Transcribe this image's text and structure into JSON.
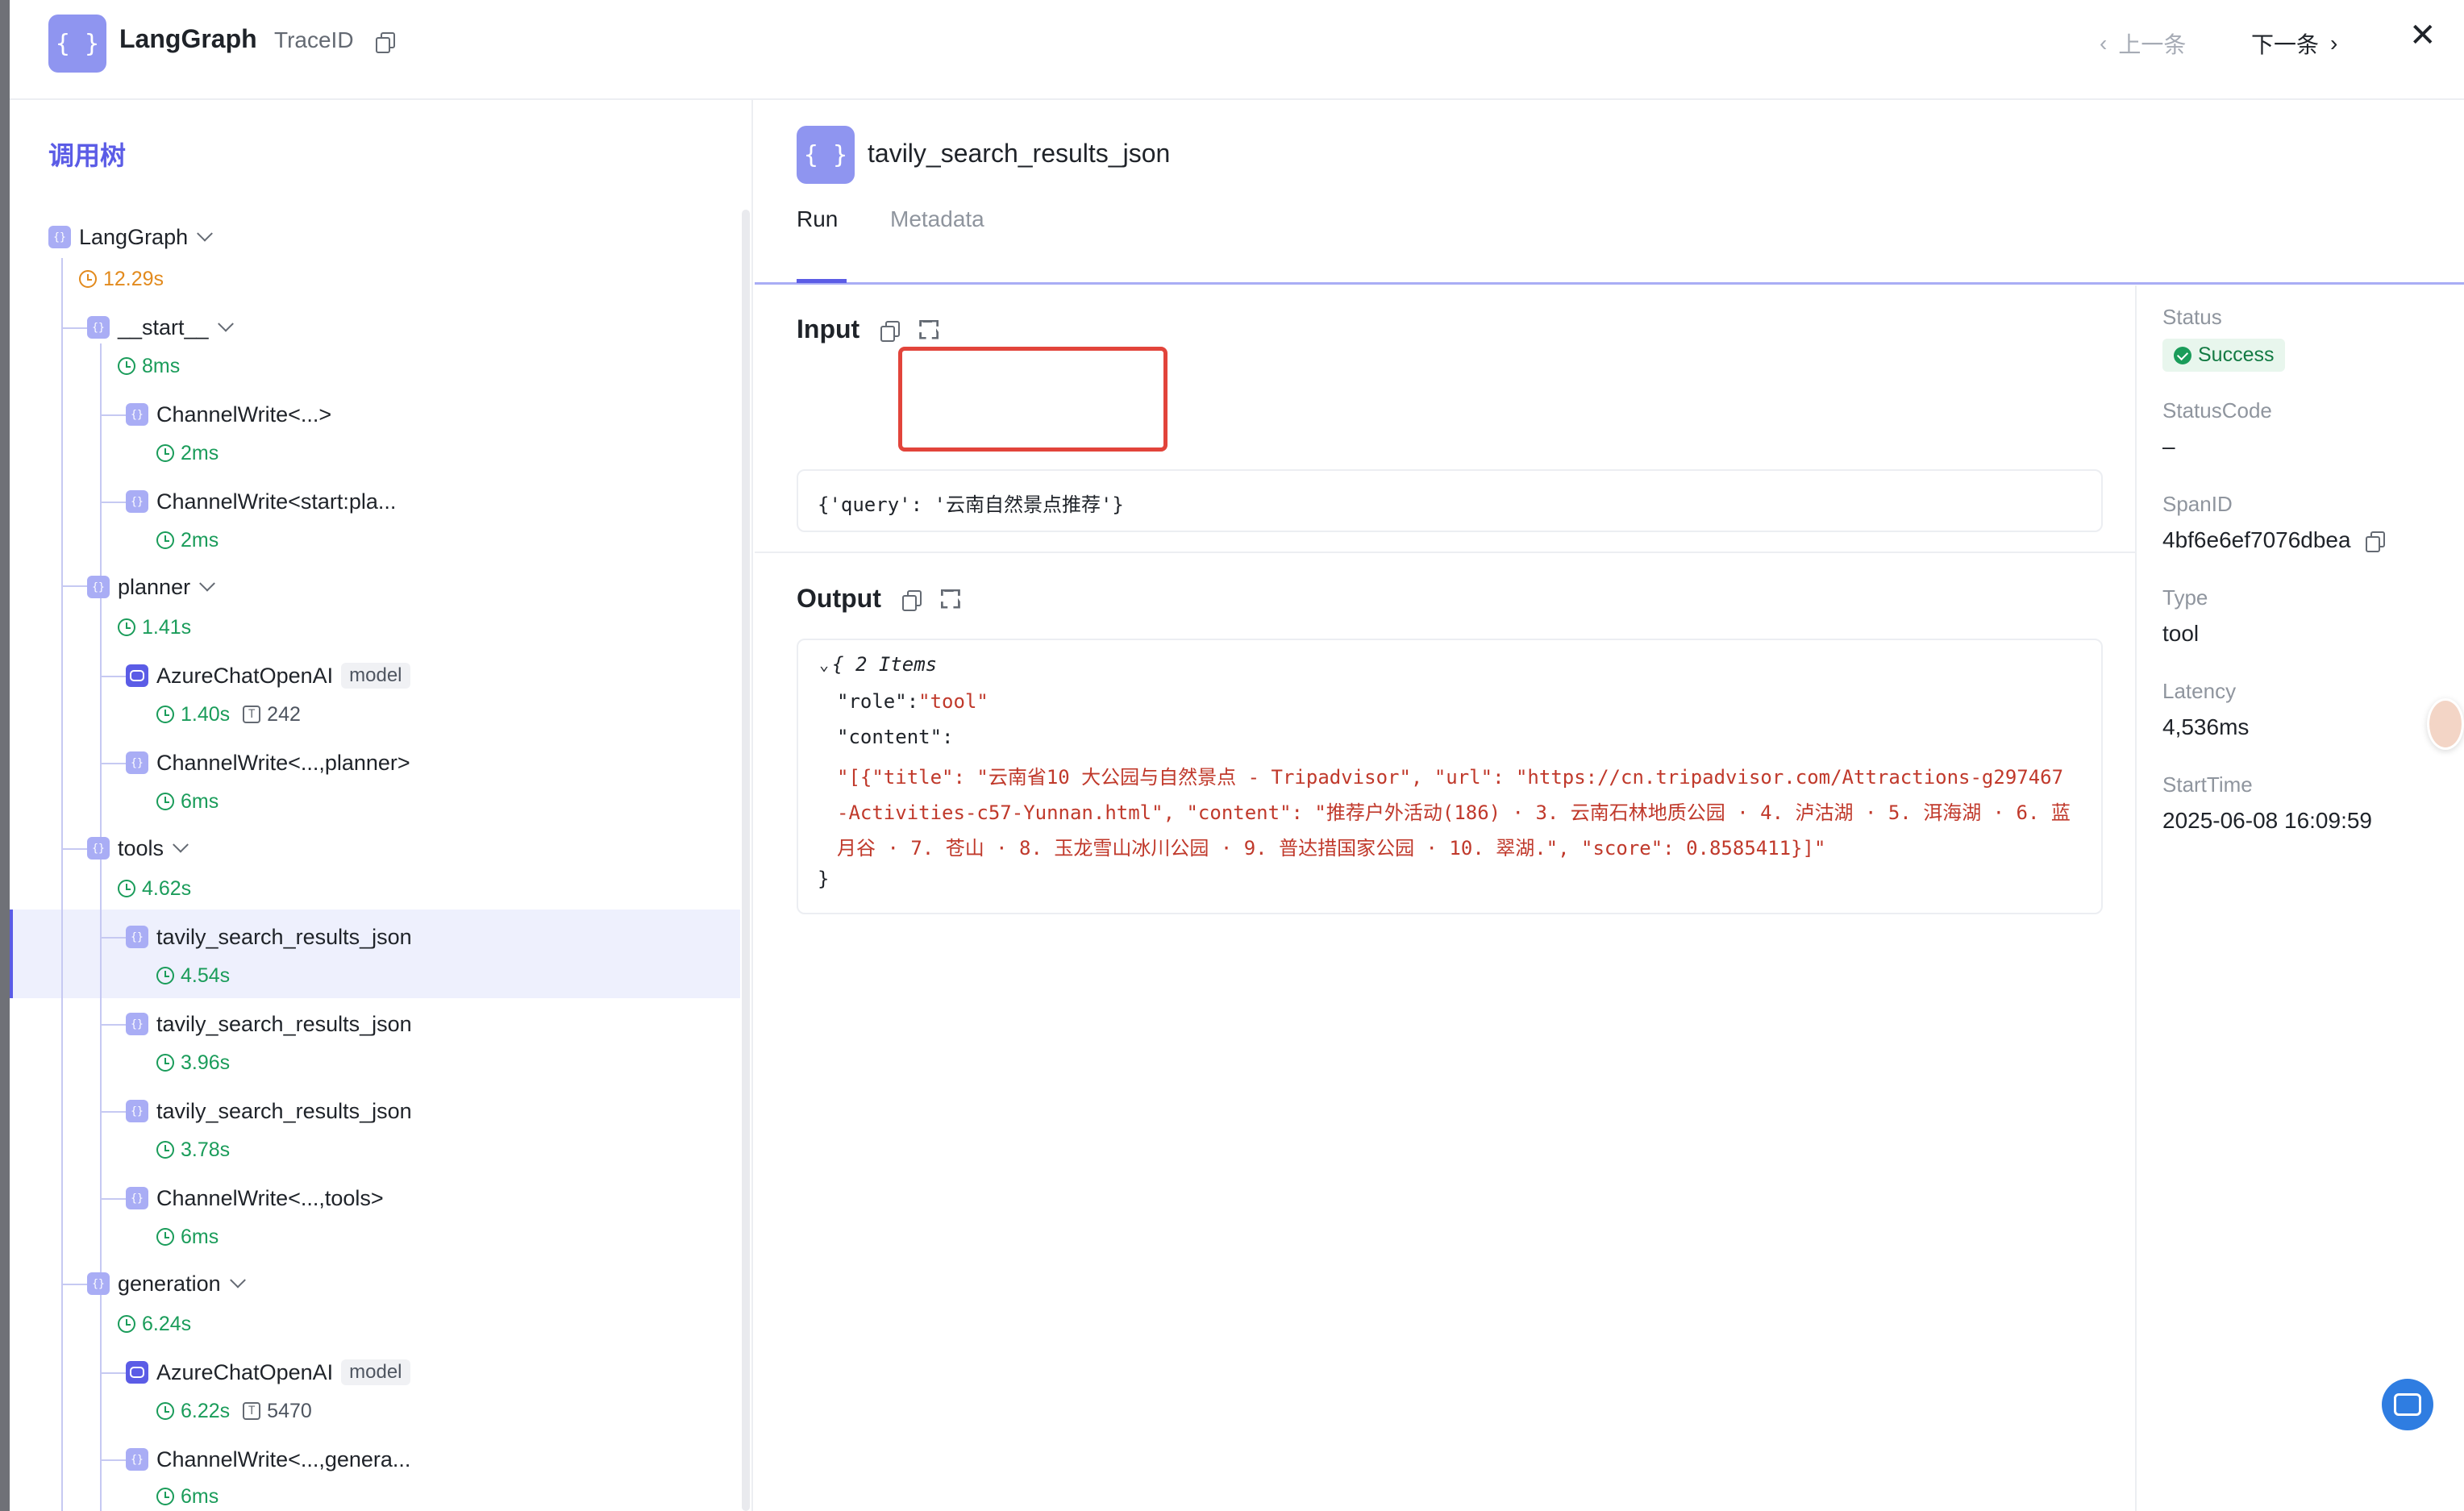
{
  "header": {
    "logo_glyph": "{ }",
    "title": "LangGraph",
    "trace_label": "TraceID",
    "prev_label": "上一条",
    "next_label": "下一条",
    "close_glyph": "✕"
  },
  "tree": {
    "title": "调用树",
    "nodes": [
      {
        "label": "LangGraph",
        "time": "12.29s"
      },
      {
        "label": "__start__",
        "time": "8ms"
      },
      {
        "label": "ChannelWrite<...>",
        "time": "2ms"
      },
      {
        "label": "ChannelWrite<start:pla...",
        "time": "2ms"
      },
      {
        "label": "planner",
        "time": "1.41s"
      },
      {
        "label": "AzureChatOpenAI",
        "tag": "model",
        "time": "1.40s",
        "tokens": "242"
      },
      {
        "label": "ChannelWrite<...,planner>",
        "time": "6ms"
      },
      {
        "label": "tools",
        "time": "4.62s"
      },
      {
        "label": "tavily_search_results_json",
        "time": "4.54s"
      },
      {
        "label": "tavily_search_results_json",
        "time": "3.96s"
      },
      {
        "label": "tavily_search_results_json",
        "time": "3.78s"
      },
      {
        "label": "ChannelWrite<...,tools>",
        "time": "6ms"
      },
      {
        "label": "generation",
        "time": "6.24s"
      },
      {
        "label": "AzureChatOpenAI",
        "tag": "model",
        "time": "6.22s",
        "tokens": "5470"
      },
      {
        "label": "ChannelWrite<...,genera...",
        "time": "6ms"
      }
    ]
  },
  "detail": {
    "icon_glyph": "{ }",
    "title": "tavily_search_results_json",
    "tabs": {
      "run": "Run",
      "metadata": "Metadata"
    },
    "input": {
      "title": "Input",
      "code": "{'query': '云南自然景点推荐'}"
    },
    "output": {
      "title": "Output",
      "summary": "{ 2 Items",
      "role_key": "\"role\":",
      "role_value": "\"tool\"",
      "content_key": "\"content\":",
      "content_line1": "\"[{\"title\": \"云南省10 大公园与自然景点 - Tripadvisor\", \"url\": \"https://cn.tripadvisor.com/Attractions-g297467",
      "content_line2": "-Activities-c57-Yunnan.html\", \"content\": \"推荐户外活动(186) · 3. 云南石林地质公园 · 4. 泸沽湖 · 5. 洱海湖 · 6. 蓝",
      "content_line3": "月谷 · 7. 苍山 · 8. 玉龙雪山冰川公园 · 9. 普达措国家公园 · 10. 翠湖.\", \"score\": 0.8585411}]\"",
      "close": "}"
    }
  },
  "meta": {
    "status_label": "Status",
    "status_value": "Success",
    "statuscode_label": "StatusCode",
    "statuscode_value": "–",
    "spanid_label": "SpanID",
    "spanid_value": "4bf6e6ef7076dbea",
    "type_label": "Type",
    "type_value": "tool",
    "latency_label": "Latency",
    "latency_value": "4,536ms",
    "starttime_label": "StartTime",
    "starttime_value": "2025-06-08 16:09:59"
  }
}
